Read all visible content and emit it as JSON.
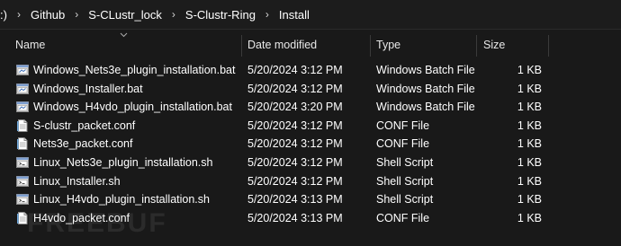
{
  "breadcrumb": {
    "items": [
      ":)",
      "Github",
      "S-CLustr_lock",
      "S-Clustr-Ring",
      "Install"
    ]
  },
  "columns": {
    "name": "Name",
    "date": "Date modified",
    "type": "Type",
    "size": "Size"
  },
  "files": [
    {
      "name": "Windows_Nets3e_plugin_installation.bat",
      "date": "5/20/2024 3:12 PM",
      "type": "Windows Batch File",
      "size": "1 KB",
      "icon": "batch-file-icon"
    },
    {
      "name": "Windows_Installer.bat",
      "date": "5/20/2024 3:12 PM",
      "type": "Windows Batch File",
      "size": "1 KB",
      "icon": "batch-file-icon"
    },
    {
      "name": "Windows_H4vdo_plugin_installation.bat",
      "date": "5/20/2024 3:20 PM",
      "type": "Windows Batch File",
      "size": "1 KB",
      "icon": "batch-file-icon"
    },
    {
      "name": "S-clustr_packet.conf",
      "date": "5/20/2024 3:12 PM",
      "type": "CONF File",
      "size": "1 KB",
      "icon": "conf-file-icon"
    },
    {
      "name": "Nets3e_packet.conf",
      "date": "5/20/2024 3:12 PM",
      "type": "CONF File",
      "size": "1 KB",
      "icon": "conf-file-icon"
    },
    {
      "name": "Linux_Nets3e_plugin_installation.sh",
      "date": "5/20/2024 3:12 PM",
      "type": "Shell Script",
      "size": "1 KB",
      "icon": "shell-script-icon"
    },
    {
      "name": "Linux_Installer.sh",
      "date": "5/20/2024 3:12 PM",
      "type": "Shell Script",
      "size": "1 KB",
      "icon": "shell-script-icon"
    },
    {
      "name": "Linux_H4vdo_plugin_installation.sh",
      "date": "5/20/2024 3:13 PM",
      "type": "Shell Script",
      "size": "1 KB",
      "icon": "shell-script-icon"
    },
    {
      "name": "H4vdo_packet.conf",
      "date": "5/20/2024 3:13 PM",
      "type": "CONF File",
      "size": "1 KB",
      "icon": "conf-file-icon"
    }
  ],
  "watermark": "FREEBUF",
  "colors": {
    "background": "#191919",
    "text": "#ffffff",
    "divider": "#3a3a3a"
  }
}
